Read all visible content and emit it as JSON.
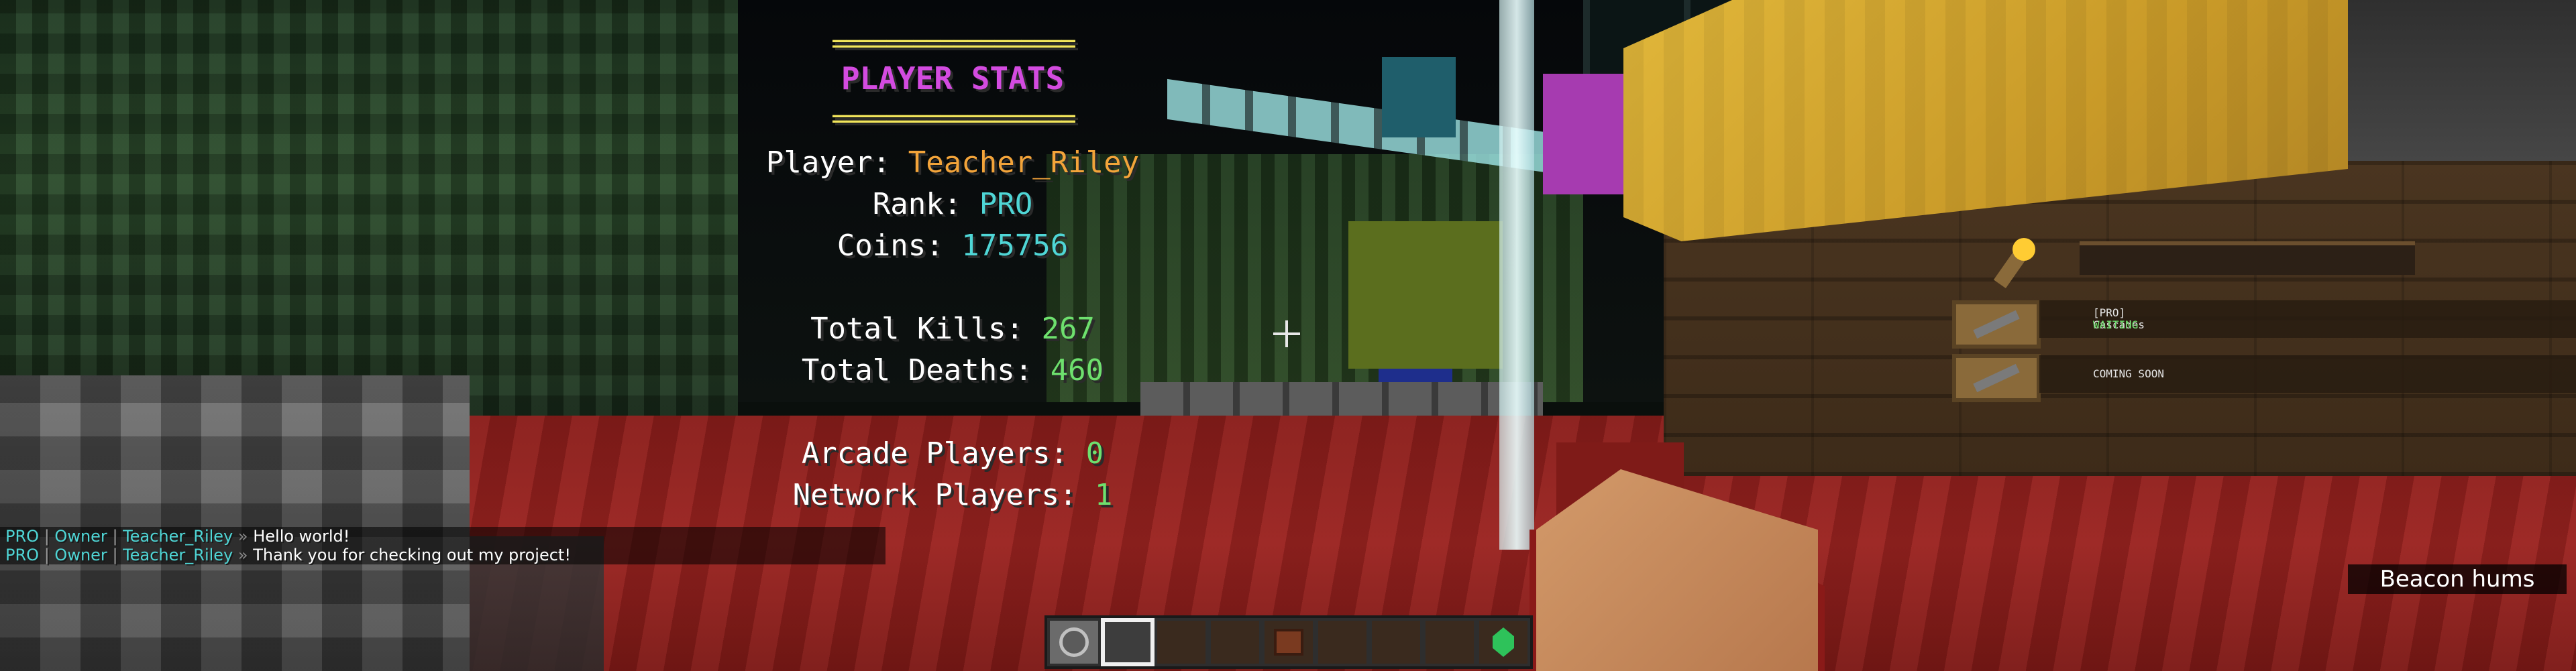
{
  "scoreboard": {
    "rule_top": "==================",
    "title": "PLAYER STATS",
    "rule_bottom": "==================",
    "player_label": "Player:",
    "player_value": "Teacher_Riley",
    "rank_label": "Rank:",
    "rank_value": "PRO",
    "coins_label": "Coins:",
    "coins_value": "175756",
    "kills_label": "Total Kills:",
    "kills_value": "267",
    "deaths_label": "Total Deaths:",
    "deaths_value": "460",
    "arcade_label": "Arcade Players:",
    "arcade_value": "0",
    "network_label": "Network Players:",
    "network_value": "1"
  },
  "chat": {
    "lines": [
      {
        "rank": "PRO",
        "sep1": "|",
        "role": "Owner",
        "sep2": "|",
        "name": "Teacher_Riley",
        "arrow": "»",
        "message": "Hello world!"
      },
      {
        "rank": "PRO",
        "sep1": "|",
        "role": "Owner",
        "sep2": "|",
        "name": "Teacher_Riley",
        "arrow": "»",
        "message": "Thank you for checking out my project!"
      }
    ]
  },
  "subtitle": {
    "text": "Beacon hums"
  },
  "signs": {
    "sign1_line1": "[PRO]",
    "sign1_line2": "Cascades",
    "sign1_line3": "WAITING",
    "sign1_line4": "0/16",
    "sign2_line1": "COMING SOON"
  },
  "hotbar": {
    "selected_slot": 1,
    "slots": [
      {
        "item": "compass-icon"
      },
      {
        "item": "empty"
      },
      {
        "item": "empty"
      },
      {
        "item": "empty"
      },
      {
        "item": "chest-icon"
      },
      {
        "item": "empty"
      },
      {
        "item": "empty"
      },
      {
        "item": "empty"
      },
      {
        "item": "emerald-icon"
      }
    ]
  },
  "colors": {
    "rule": "#f2e55c",
    "title": "#d34be0",
    "player": "#f3a43a",
    "aqua": "#4fd6d6",
    "green": "#6ee06e",
    "floor": "#9b2320"
  }
}
